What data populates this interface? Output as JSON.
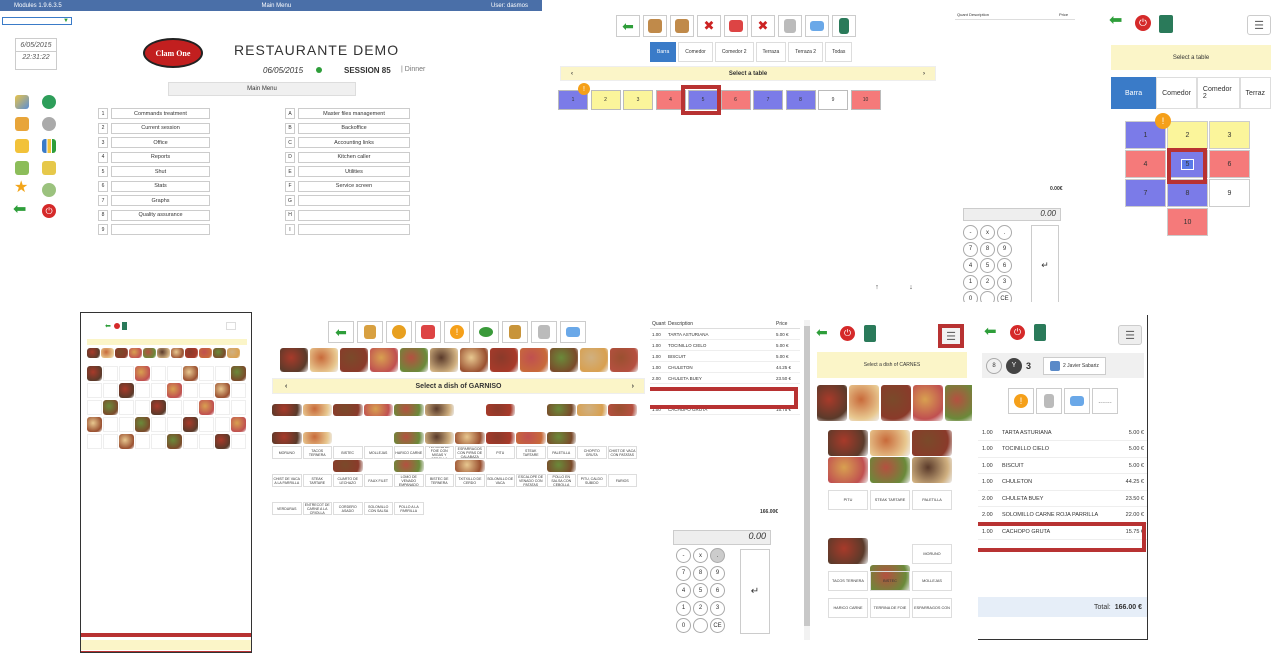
{
  "main_panel": {
    "top_bar": {
      "version": "Modules 1.9.6.3.5",
      "title": "Main Menu",
      "user": "User: dasmos"
    },
    "date": "6/05/2015",
    "time": "22:31:22",
    "logo": "Clam One",
    "restaurant": "RESTAURANTE DEMO",
    "session_date": "06/05/2015",
    "session": "SESSION 85",
    "session_type": "| Dinner",
    "menu_title": "Main Menu",
    "left_menu": [
      {
        "key": "1",
        "label": "Commands treatment"
      },
      {
        "key": "2",
        "label": "Current session"
      },
      {
        "key": "3",
        "label": "Office"
      },
      {
        "key": "4",
        "label": "Reports"
      },
      {
        "key": "5",
        "label": "Shut"
      },
      {
        "key": "6",
        "label": "Stats"
      },
      {
        "key": "7",
        "label": "Graphs"
      },
      {
        "key": "8",
        "label": "Quality assurance"
      },
      {
        "key": "9",
        "label": ""
      }
    ],
    "right_menu": [
      {
        "key": "A",
        "label": "Master files management"
      },
      {
        "key": "B",
        "label": "Backoffice"
      },
      {
        "key": "C",
        "label": "Accounting links"
      },
      {
        "key": "D",
        "label": "Kitchen caller"
      },
      {
        "key": "E",
        "label": "Utilities"
      },
      {
        "key": "F",
        "label": "Service screen"
      },
      {
        "key": "G",
        "label": ""
      },
      {
        "key": "H",
        "label": ""
      },
      {
        "key": "I",
        "label": ""
      }
    ]
  },
  "tables_panel": {
    "tabs": [
      "Barra",
      "Comedor",
      "Comedor 2",
      "Terraza",
      "Terraza 2",
      "Todas"
    ],
    "header": "Select a table",
    "tables": [
      "1",
      "2",
      "3",
      "4",
      "5",
      "6",
      "7",
      "8",
      "9",
      "10"
    ],
    "ticket_headers": {
      "qty": "Quant",
      "desc": "Description",
      "price": "Price"
    },
    "total": "0.00€",
    "display": "0.00",
    "keys": [
      "-",
      "x",
      ".",
      "7",
      "8",
      "9",
      "4",
      "5",
      "6",
      "1",
      "2",
      "3",
      "0",
      "",
      "CE"
    ],
    "enter": "↵",
    "arrows": [
      "↑",
      "↓"
    ]
  },
  "mobile_tables": {
    "header": "Select a table",
    "tabs": [
      "Barra",
      "Comedor",
      "Comedor 2",
      "Terraz"
    ],
    "tables": [
      "1",
      "2",
      "3",
      "4",
      "5",
      "6",
      "7",
      "8",
      "9",
      "10"
    ],
    "badge": "!"
  },
  "dish_panel": {
    "header": "Select a dish of GARNISO",
    "dishes": [
      "MORUNO",
      "TACOS TERNERA",
      "BISTEC",
      "MOLLEJAS",
      "HARICO CARNE",
      "TERRINA DE FOIE CON MIGAS Y CEBOLLA",
      "ESPARRAGOS CON PIPAS DE CALABAZA",
      "PITU",
      "STEAK TARTARE",
      "PALETILLA",
      "CHOPITO GRUTA",
      "CHIST DE VACA CON PATATAS",
      "CHIST DE VACA A LA PARRILLA",
      "STEAK TARTARE",
      "CUARTO DE LECHAZO",
      "FAUX FILET",
      "LOMO DE VENADO EMPANADO",
      "BISTEC DE TERNERA",
      "TXITXILLO DE CERDO",
      "SOLOMILLO DE VACA",
      "ESCALOPE DE VENADO CON PATATAS",
      "POLLO EN SALSA CON CEBOLLA",
      "PITU, CALDO SUBIDO",
      "FARIOS",
      "VERDURAS",
      "ENTRECOT DE CARNE A LA CRIOLLA",
      "CORDERO ASADO",
      "SOLOMILLO CON SALSA",
      "POLLO A LA PARRILLA"
    ]
  },
  "ticket_panel": {
    "headers": {
      "qty": "Quant",
      "desc": "Description",
      "price": "Price"
    },
    "lines": [
      {
        "qty": "1.00",
        "desc": "TARTA ASTURIANA",
        "price": "5.00 €"
      },
      {
        "qty": "1.00",
        "desc": "TOCINILLO CIELO",
        "price": "5.00 €"
      },
      {
        "qty": "1.00",
        "desc": "BISCUIT",
        "price": "5.00 €"
      },
      {
        "qty": "1.00",
        "desc": "CHULETON",
        "price": "44.25 €"
      },
      {
        "qty": "2.00",
        "desc": "CHULETA BUEY",
        "price": "23.50 €"
      },
      {
        "qty": "1.00",
        "desc": "CACHOPO GRUTA",
        "price": "15.75 €"
      }
    ],
    "total": "166.00€",
    "display": "0.00",
    "keys": [
      "-",
      "x",
      ".",
      "7",
      "8",
      "9",
      "4",
      "5",
      "6",
      "1",
      "2",
      "3",
      "0",
      "",
      "CE"
    ],
    "enter": "↵"
  },
  "mobile_dishes": {
    "header": "Select a dish of CARNES",
    "dishes": [
      "PITU",
      "STEAK TARTARE",
      "PALETILLA",
      "",
      "",
      "MORUNO",
      "TACOS TERNERA",
      "BISTEC",
      "MOLLEJAS",
      "HARICO CARNE",
      "TERRINA DE FOIE",
      "ESPARRAGOS CON"
    ]
  },
  "mobile_ticket": {
    "people_count": "3",
    "waiter": "2 Javier Sabariz",
    "badge": "!",
    "lines": [
      {
        "qty": "1.00",
        "desc": "TARTA ASTURIANA",
        "price": "5.00 €"
      },
      {
        "qty": "1.00",
        "desc": "TOCINILLO CIELO",
        "price": "5.00 €"
      },
      {
        "qty": "1.00",
        "desc": "BISCUIT",
        "price": "5.00 €"
      },
      {
        "qty": "1.00",
        "desc": "CHULETON",
        "price": "44.25 €"
      },
      {
        "qty": "2.00",
        "desc": "CHULETA BUEY",
        "price": "23.50 €"
      },
      {
        "qty": "2.00",
        "desc": "SOLOMILLO CARNE ROJA PARRILLA",
        "price": "22.00 €"
      },
      {
        "qty": "1.00",
        "desc": "CACHOPO GRUTA",
        "price": "15.75 €"
      }
    ],
    "total_label": "Total:",
    "total": "166.00 €"
  },
  "colors": {
    "accent": "#3a7bc8",
    "yellow": "#fbf59b",
    "red": "#f57a7a",
    "blue": "#7b7be8",
    "highlight": "#b83232",
    "green_icon": "#2e9e3a"
  }
}
